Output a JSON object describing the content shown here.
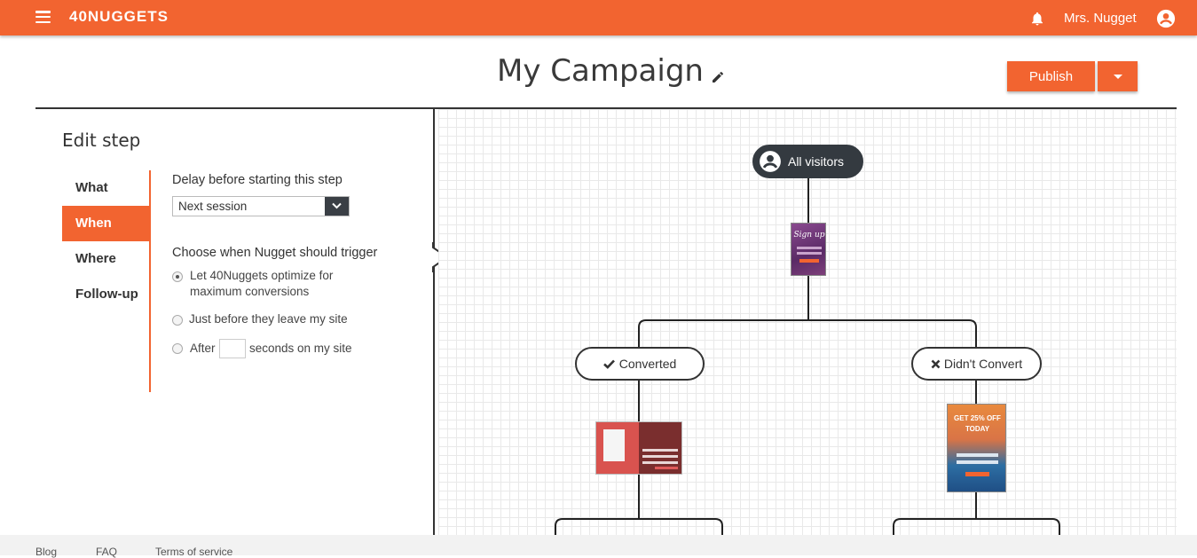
{
  "header": {
    "logo": "40NUGGETS",
    "username": "Mrs. Nugget",
    "menu_icon": "hamburger-menu-icon",
    "bell_icon": "bell-icon",
    "user_icon": "user-circle-icon"
  },
  "page": {
    "title": "My Campaign",
    "edit_icon": "pencil-icon",
    "publish_label": "Publish"
  },
  "edit_step": {
    "title": "Edit step",
    "nav": [
      {
        "label": "What",
        "active": false
      },
      {
        "label": "When",
        "active": true
      },
      {
        "label": "Where",
        "active": false
      },
      {
        "label": "Follow-up",
        "active": false
      }
    ],
    "delay_label": "Delay before starting this step",
    "delay_value": "Next session",
    "trigger_label": "Choose when Nugget should trigger",
    "trigger_options": [
      {
        "label_line1": "Let 40Nuggets optimize for",
        "label_line2": "maximum conversions",
        "checked": true
      },
      {
        "label": "Just before they leave my site",
        "checked": false
      },
      {
        "label_before": "After",
        "label_after": "seconds on my site",
        "checked": false
      }
    ],
    "seconds_value": ""
  },
  "flow": {
    "root": "All visitors",
    "branch_yes": "Converted",
    "branch_no": "Didn't Convert",
    "thumb1_text": "Sign up",
    "thumb3_line1": "GET 25% OFF",
    "thumb3_line2": "TODAY"
  },
  "colors": {
    "brand": "#f26430",
    "dark": "#343a40"
  },
  "footer": {
    "links": [
      "Blog",
      "FAQ",
      "Terms of service"
    ]
  }
}
